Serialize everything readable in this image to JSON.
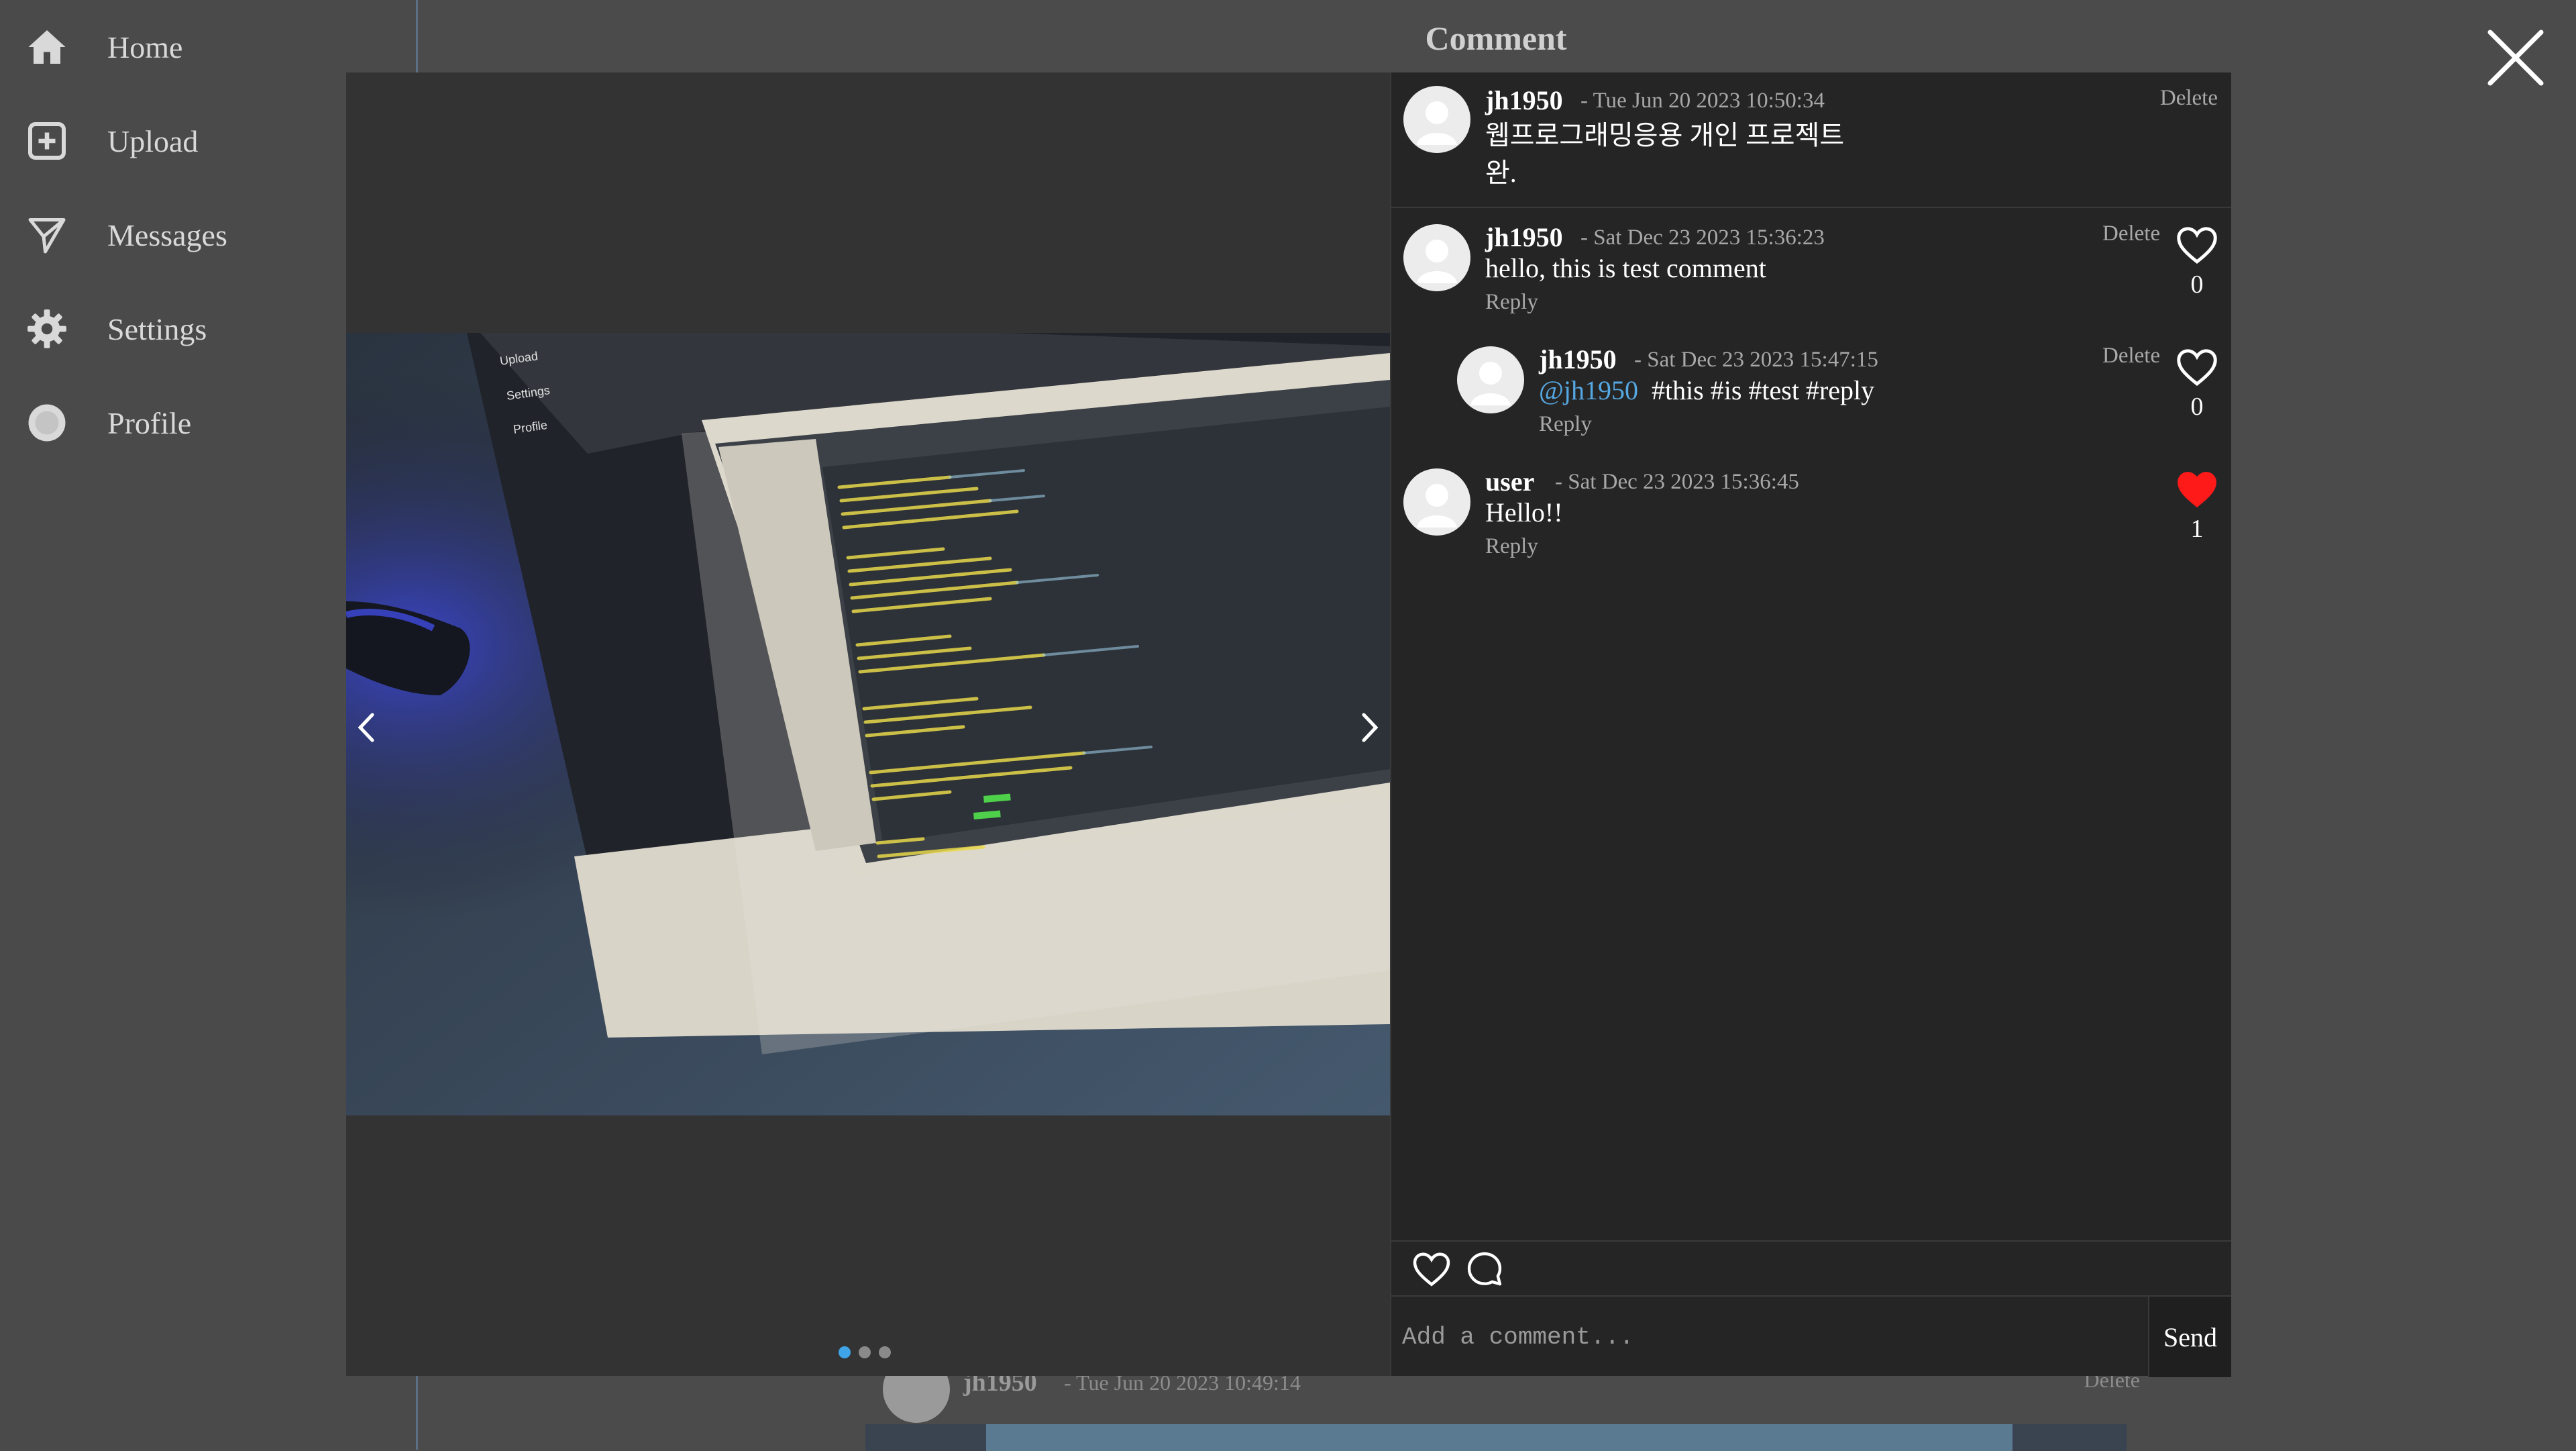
{
  "sidebar": {
    "items": [
      {
        "label": "Home",
        "icon": "home-icon"
      },
      {
        "label": "Upload",
        "icon": "plus-square-icon"
      },
      {
        "label": "Messages",
        "icon": "send-icon"
      },
      {
        "label": "Settings",
        "icon": "gear-icon"
      },
      {
        "label": "Profile",
        "icon": "avatar-icon"
      }
    ]
  },
  "background_post": {
    "username": "jh1950",
    "date": "- Tue Jun 20 2023 10:49:14",
    "delete_label": "Delete"
  },
  "modal": {
    "title": "Comment",
    "carousel": {
      "total": 3,
      "active": 1
    }
  },
  "comments": [
    {
      "username": "jh1950",
      "date": "- Tue Jun 20 2023 10:50:34",
      "text_line1": "웹프로그래밍응용 개인 프로젝트",
      "text_line2": "완.",
      "delete_label": "Delete"
    },
    {
      "username": "jh1950",
      "date": "- Sat Dec 23 2023 15:36:23",
      "text": "hello, this is test comment",
      "reply_label": "Reply",
      "delete_label": "Delete",
      "likes": "0",
      "liked": false
    },
    {
      "username": "jh1950",
      "date": "- Sat Dec 23 2023 15:47:15",
      "mention": "@jh1950",
      "text": "#this #is #test #reply",
      "reply_label": "Reply",
      "delete_label": "Delete",
      "likes": "0",
      "liked": false
    },
    {
      "username": "user",
      "date": "- Sat Dec 23 2023 15:36:45",
      "text": "Hello!!",
      "reply_label": "Reply",
      "likes": "1",
      "liked": true
    }
  ],
  "composer": {
    "placeholder": "Add a comment...",
    "send_label": "Send"
  },
  "colors": {
    "accent": "#3fa4e8",
    "mention": "#56a8e3",
    "liked_heart": "#ff1a1a"
  }
}
